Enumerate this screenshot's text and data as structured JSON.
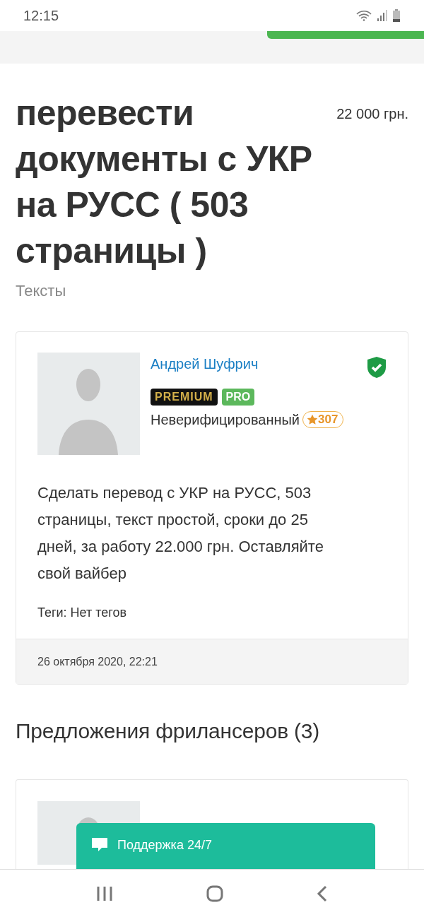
{
  "status_bar": {
    "time": "12:15"
  },
  "task": {
    "title": "перевести документы с УКР на РУСС ( 503 страницы )",
    "price": "22 000 грн.",
    "category": "Тексты"
  },
  "author": {
    "name": "Андрей Шуфрич",
    "verified": true,
    "badges": [
      {
        "kind": "premium",
        "label": "PREMIUM"
      },
      {
        "kind": "pro",
        "label": "PRO"
      }
    ],
    "status": "Неверифицированный",
    "rating": "307"
  },
  "description": "Сделать перевод с УКР на РУСС, 503 страницы, текст простой, сроки до 25 дней, за работу 22.000 грн. Оставляйте свой вайбер",
  "tags": "Теги: Нет тегов",
  "date": "26 октября 2020, 22:21",
  "offers": {
    "heading": "Предложения фрилансеров (3)"
  },
  "support_button": {
    "label": "Поддержка 24/7"
  }
}
